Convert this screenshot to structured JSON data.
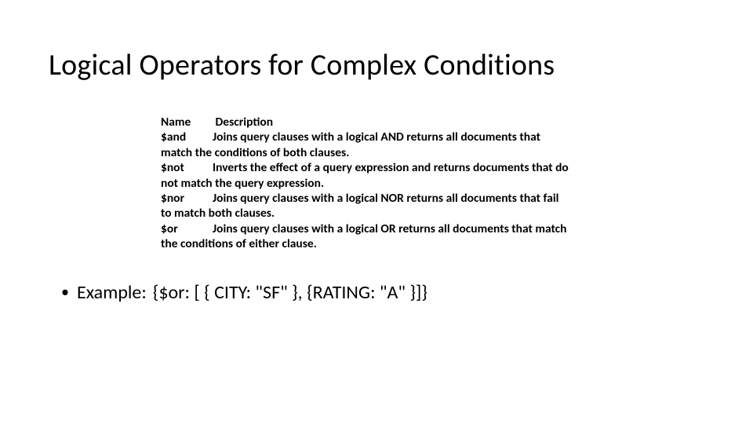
{
  "title": "Logical Operators for Complex Conditions",
  "header": {
    "name": "Name",
    "desc": "Description"
  },
  "ops": [
    {
      "name": "$and",
      "desc": "Joins query clauses with a logical AND returns all documents that match the conditions of both clauses."
    },
    {
      "name": "$not",
      "desc": "Inverts the effect of a query expression and returns documents that do not match the query expression."
    },
    {
      "name": "$nor",
      "desc": "Joins query clauses with a logical NOR returns all documents that fail to match both clauses."
    },
    {
      "name": "$or",
      "desc": "Joins query clauses with a logical OR returns all documents that match the conditions of either clause."
    }
  ],
  "example": {
    "bullet": "•",
    "label": "Example:",
    "code": "{$or: [ { CITY: \"SF\" }, {RATING: \"A\" }]}"
  }
}
